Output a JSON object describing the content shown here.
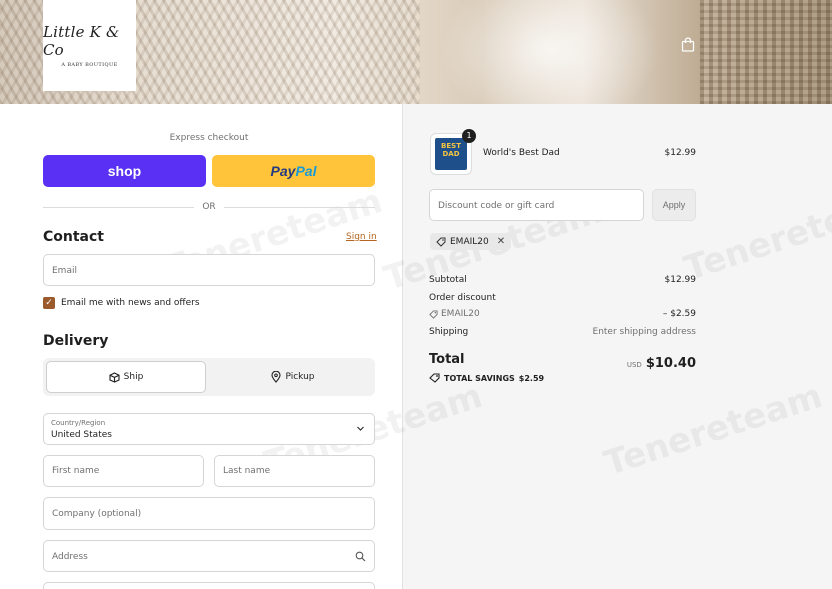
{
  "header": {
    "logo_text": "Little K & Co",
    "logo_subtitle": "A BABY BOUTIQUE",
    "cart_icon": "shopping-bag-icon"
  },
  "express": {
    "label": "Express checkout",
    "shop_label": "shop",
    "paypal_part1": "Pay",
    "paypal_part2": "Pal",
    "divider": "OR"
  },
  "contact": {
    "heading": "Contact",
    "sign_in": "Sign in",
    "email_placeholder": "Email",
    "newsletter_label": "Email me with news and offers",
    "newsletter_checked": true
  },
  "delivery": {
    "heading": "Delivery",
    "ship_label": "Ship",
    "pickup_label": "Pickup",
    "country_label": "Country/Region",
    "country_value": "United States",
    "first_name_placeholder": "First name",
    "last_name_placeholder": "Last name",
    "company_placeholder": "Company (optional)",
    "address_placeholder": "Address"
  },
  "summary": {
    "item": {
      "name": "World's Best Dad",
      "price": "$12.99",
      "quantity": "1",
      "thumb_text": "BEST DAD"
    },
    "discount_placeholder": "Discount code or gift card",
    "apply_label": "Apply",
    "applied_code": "EMAIL20",
    "subtotal_label": "Subtotal",
    "subtotal_value": "$12.99",
    "order_discount_label": "Order discount",
    "discount_code": "EMAIL20",
    "discount_value": "– $2.59",
    "shipping_label": "Shipping",
    "shipping_value": "Enter shipping address",
    "total_label": "Total",
    "currency": "USD",
    "total_value": "$10.40",
    "savings_label": "TOTAL SAVINGS",
    "savings_value": "$2.59"
  },
  "watermark": "Tenereteam",
  "colors": {
    "shop_pay": "#5a31f4",
    "paypal": "#ffc439",
    "accent": "#9a5a2c"
  }
}
